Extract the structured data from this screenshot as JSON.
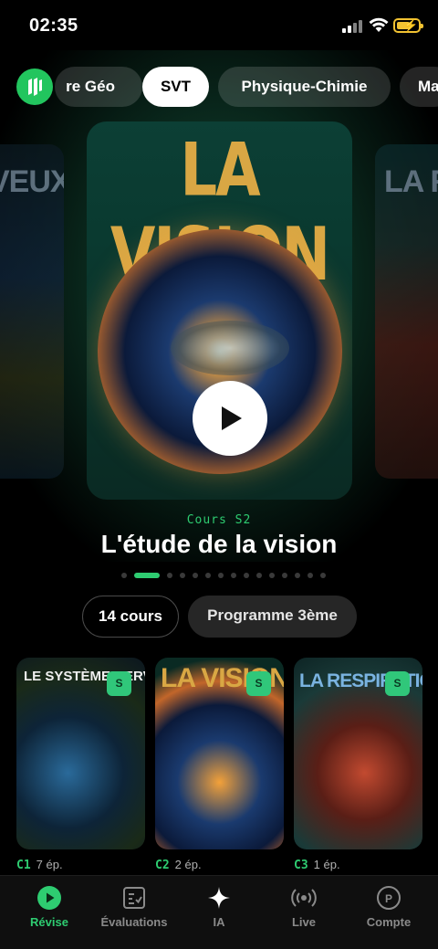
{
  "status_bar": {
    "time": "02:35"
  },
  "subjects": {
    "items": [
      {
        "label": "re Géo",
        "active": false
      },
      {
        "label": "SVT",
        "active": true
      },
      {
        "label": "Physique-Chimie",
        "active": false
      },
      {
        "label": "Ma",
        "active": false
      }
    ]
  },
  "carousel": {
    "left_card_title": "VEUX",
    "center_card_title": "LA VISION",
    "right_card_title": "LA R",
    "active_index": 1,
    "dot_count": 15
  },
  "featured": {
    "label": "Cours S2",
    "title": "L'étude de la vision"
  },
  "chips": {
    "count": "14 cours",
    "program": "Programme 3ème"
  },
  "courses": [
    {
      "title": "LE SYSTÈME NERVEUX",
      "badge": "S",
      "code": "C1",
      "episodes": "7 ép."
    },
    {
      "title": "LA VISION",
      "badge": "S",
      "code": "C2",
      "episodes": "2 ép."
    },
    {
      "title": "LA RESPIRATION",
      "badge": "S",
      "code": "C3",
      "episodes": "1 ép."
    }
  ],
  "nav": {
    "items": [
      {
        "label": "Révise",
        "icon": "play-circle-icon",
        "active": true
      },
      {
        "label": "Évaluations",
        "icon": "checklist-icon",
        "active": false
      },
      {
        "label": "IA",
        "icon": "sparkle-icon",
        "active": false
      },
      {
        "label": "Live",
        "icon": "broadcast-icon",
        "active": false
      },
      {
        "label": "Compte",
        "icon": "account-icon",
        "active": false
      }
    ]
  },
  "colors": {
    "accent": "#2ecc71",
    "badge": "#30c77a"
  }
}
